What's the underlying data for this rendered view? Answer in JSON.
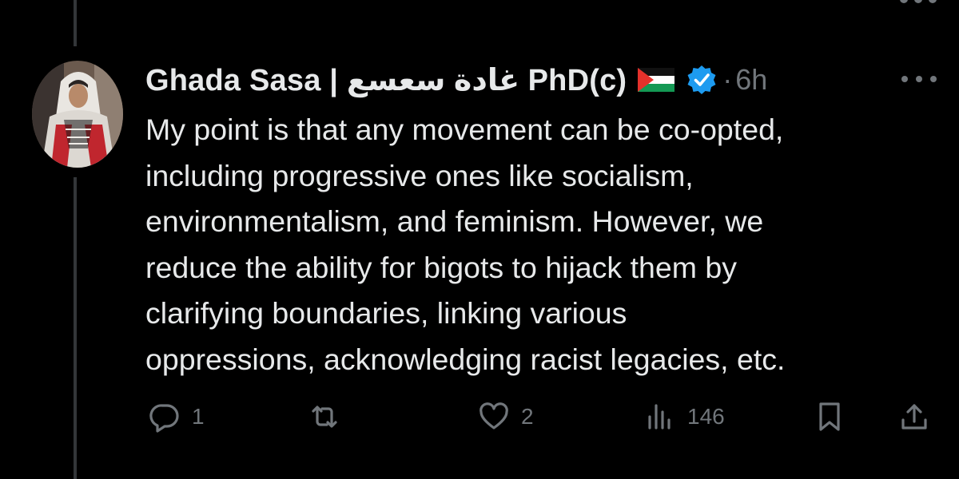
{
  "tweet": {
    "author": {
      "display_name": "Ghada Sasa | غادة سعسع PhD(c)",
      "verified": true,
      "flag": "palestine-flag"
    },
    "separator": "·",
    "timestamp": "6h",
    "text": "My point is that any movement can be co-opted,\nincluding progressive ones like socialism,\nenvironmentalism, and feminism. However, we\nreduce the ability for bigots to hijack them by\nclarifying boundaries, linking various\noppressions, acknowledging racist legacies, etc.",
    "actions": {
      "reply": {
        "icon": "reply-icon",
        "count": "1"
      },
      "retweet": {
        "icon": "retweet-icon",
        "count": ""
      },
      "like": {
        "icon": "heart-icon",
        "count": "2"
      },
      "views": {
        "icon": "views-icon",
        "count": "146"
      },
      "bookmark": {
        "icon": "bookmark-icon"
      },
      "share": {
        "icon": "share-icon"
      }
    }
  },
  "colors": {
    "background": "#000000",
    "text_primary": "#e7e9ea",
    "text_secondary": "#71767b",
    "verified_blue": "#1d9bf0",
    "thread_line": "#333639"
  }
}
